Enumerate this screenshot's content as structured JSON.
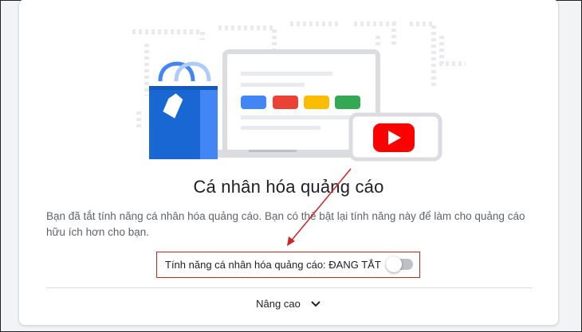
{
  "page": {
    "title": "Cá nhân hóa quảng cáo",
    "description": "Bạn đã tắt tính năng cá nhân hóa quảng cáo. Bạn có thể bật lại tính năng này để làm cho quảng cáo hữu ích hơn cho bạn."
  },
  "setting": {
    "label": "Tính năng cá nhân hóa quảng cáo: ĐANG TẮT",
    "enabled": false
  },
  "advanced": {
    "label": "Nâng cao",
    "icon": "chevron-down-icon"
  },
  "colors": {
    "blue": "#4285f4",
    "red": "#ea4335",
    "yellow": "#fbbc04",
    "green": "#34a853",
    "youtube_red": "#ff0000",
    "annotation_red": "#c62828"
  }
}
